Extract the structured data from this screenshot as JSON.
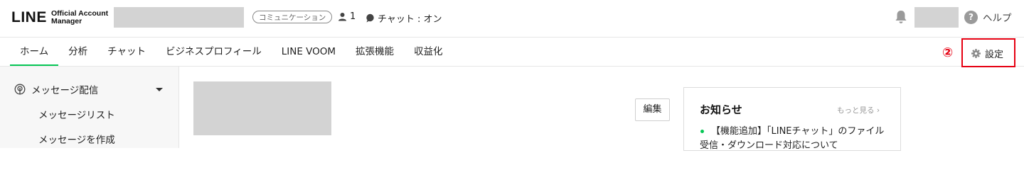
{
  "header": {
    "logo_main": "LINE",
    "logo_sub_line1": "Official Account",
    "logo_sub_line2": "Manager",
    "badge": "コミュニケーション",
    "friends_count": "1",
    "chat_status": "チャット : オン",
    "help_label": "ヘルプ",
    "help_icon": "?"
  },
  "tabs": [
    {
      "label": "ホーム",
      "active": true
    },
    {
      "label": "分析"
    },
    {
      "label": "チャット"
    },
    {
      "label": "ビジネスプロフィール"
    },
    {
      "label": "LINE VOOM"
    },
    {
      "label": "拡張機能"
    },
    {
      "label": "収益化"
    }
  ],
  "annotation": {
    "number": "②"
  },
  "settings": {
    "label": "設定"
  },
  "sidebar": {
    "section": "メッセージ配信",
    "items": [
      "メッセージリスト",
      "メッセージを作成"
    ]
  },
  "main": {
    "edit_label": "編集",
    "notice": {
      "title": "お知らせ",
      "more": "もっと見る",
      "item": "【機能追加】「LINEチャット」のファイル受信・ダウンロード対応について"
    }
  },
  "colors": {
    "accent": "#06c755",
    "annotation": "#e60012"
  }
}
